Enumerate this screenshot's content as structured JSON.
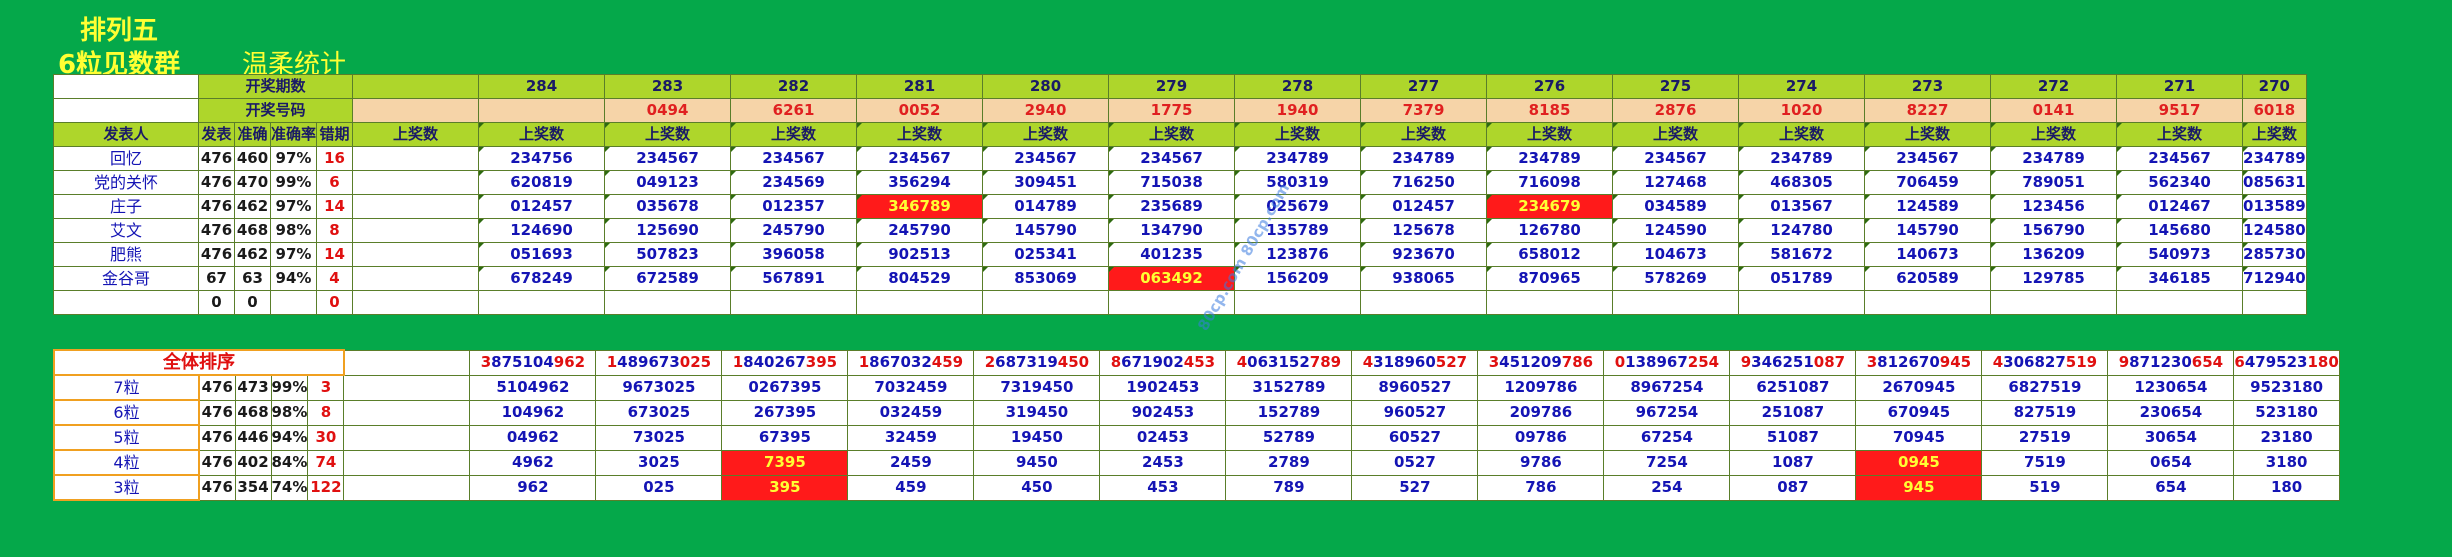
{
  "title_line1": "排列五",
  "title_line2": "6粒见数群",
  "subtitle": "温柔统计",
  "labels": {
    "period_count": "开奖期数",
    "draw_number": "开奖号码",
    "publisher": "发表人",
    "col_pub": "发表",
    "col_acc": "准确",
    "col_rate": "准确率",
    "col_miss": "错期",
    "col_upcount": "上奖数",
    "overall_rank": "全体排序",
    "watermark": "80cp.com 80cp.com"
  },
  "periods": [
    "284",
    "283",
    "282",
    "281",
    "280",
    "279",
    "278",
    "277",
    "276",
    "275",
    "274",
    "273",
    "272",
    "271",
    "270"
  ],
  "draw_numbers": [
    "",
    "0494",
    "6261",
    "0052",
    "2940",
    "1775",
    "1940",
    "7379",
    "8185",
    "2876",
    "1020",
    "8227",
    "0141",
    "9517",
    "6018"
  ],
  "upcount_header": "上奖数",
  "people": [
    {
      "name": "回忆",
      "pub": "476",
      "acc": "460",
      "rate": "97%",
      "miss": "16",
      "vals": [
        "234756",
        "234567",
        "234567",
        "234567",
        "234567",
        "234567",
        "234789",
        "234789",
        "234789",
        "234567",
        "234789",
        "234567",
        "234789",
        "234567",
        "234789"
      ]
    },
    {
      "name": "党的关怀",
      "pub": "476",
      "acc": "470",
      "rate": "99%",
      "miss": "6",
      "vals": [
        "620819",
        "049123",
        "234569",
        "356294",
        "309451",
        "715038",
        "580319",
        "716250",
        "716098",
        "127468",
        "468305",
        "706459",
        "789051",
        "562340",
        "085631"
      ]
    },
    {
      "name": "庄子",
      "pub": "476",
      "acc": "462",
      "rate": "97%",
      "miss": "14",
      "vals": [
        "012457",
        "035678",
        "012357",
        "346789",
        "014789",
        "235689",
        "025679",
        "012457",
        "234679",
        "034589",
        "013567",
        "124589",
        "123456",
        "012467",
        "013589"
      ]
    },
    {
      "name": "艾文",
      "pub": "476",
      "acc": "468",
      "rate": "98%",
      "miss": "8",
      "vals": [
        "124690",
        "125690",
        "245790",
        "245790",
        "145790",
        "134790",
        "135789",
        "125678",
        "126780",
        "124590",
        "124780",
        "145790",
        "156790",
        "145680",
        "124580"
      ]
    },
    {
      "name": "肥熊",
      "pub": "476",
      "acc": "462",
      "rate": "97%",
      "miss": "14",
      "vals": [
        "051693",
        "507823",
        "396058",
        "902513",
        "025341",
        "401235",
        "123876",
        "923670",
        "658012",
        "104673",
        "581672",
        "140673",
        "136209",
        "540973",
        "285730"
      ]
    },
    {
      "name": "金谷哥",
      "pub": "67",
      "acc": "63",
      "rate": "94%",
      "miss": "4",
      "vals": [
        "678249",
        "672589",
        "567891",
        "804529",
        "853069",
        "063492",
        "156209",
        "938065",
        "870965",
        "578269",
        "051789",
        "620589",
        "129785",
        "346185",
        "712940"
      ]
    }
  ],
  "empty_row": {
    "pub": "0",
    "acc": "0",
    "miss": "0"
  },
  "rank_full": [
    "3875104962",
    "1489673025",
    "1840267395",
    "1867032459",
    "2687319450",
    "8671902453",
    "4063152789",
    "4318960527",
    "3451209786",
    "0138967254",
    "9346251087",
    "3812670945",
    "4306827519",
    "9871230654",
    "6479523180"
  ],
  "groups": [
    {
      "name": "7粒",
      "pub": "476",
      "acc": "473",
      "rate": "99%",
      "miss": "3",
      "vals": [
        "5104962",
        "9673025",
        "0267395",
        "7032459",
        "7319450",
        "1902453",
        "3152789",
        "8960527",
        "1209786",
        "8967254",
        "6251087",
        "2670945",
        "6827519",
        "1230654",
        "9523180"
      ]
    },
    {
      "name": "6粒",
      "pub": "476",
      "acc": "468",
      "rate": "98%",
      "miss": "8",
      "vals": [
        "104962",
        "673025",
        "267395",
        "032459",
        "319450",
        "902453",
        "152789",
        "960527",
        "209786",
        "967254",
        "251087",
        "670945",
        "827519",
        "230654",
        "523180"
      ]
    },
    {
      "name": "5粒",
      "pub": "476",
      "acc": "446",
      "rate": "94%",
      "miss": "30",
      "vals": [
        "04962",
        "73025",
        "67395",
        "32459",
        "19450",
        "02453",
        "52789",
        "60527",
        "09786",
        "67254",
        "51087",
        "70945",
        "27519",
        "30654",
        "23180"
      ]
    },
    {
      "name": "4粒",
      "pub": "476",
      "acc": "402",
      "rate": "84%",
      "miss": "74",
      "vals": [
        "4962",
        "3025",
        "7395",
        "2459",
        "9450",
        "2453",
        "2789",
        "0527",
        "9786",
        "7254",
        "1087",
        "0945",
        "7519",
        "0654",
        "3180"
      ]
    },
    {
      "name": "3粒",
      "pub": "476",
      "acc": "354",
      "rate": "74%",
      "miss": "122",
      "vals": [
        "962",
        "025",
        "395",
        "459",
        "450",
        "453",
        "789",
        "527",
        "786",
        "254",
        "087",
        "945",
        "519",
        "654",
        "180"
      ]
    }
  ],
  "highlights_top": [
    [
      2,
      3
    ],
    [
      2,
      8
    ],
    [
      5,
      5
    ]
  ],
  "highlights_bot": [
    [
      3,
      2
    ],
    [
      3,
      11
    ],
    [
      4,
      2
    ],
    [
      4,
      11
    ]
  ],
  "colors": {
    "background": "#05a84a",
    "header_green": "#aed62b",
    "draw_row": "#f6d4a8",
    "highlight": "#ff1a1a",
    "title": "#ffff33",
    "number_blue": "#1414b4"
  }
}
